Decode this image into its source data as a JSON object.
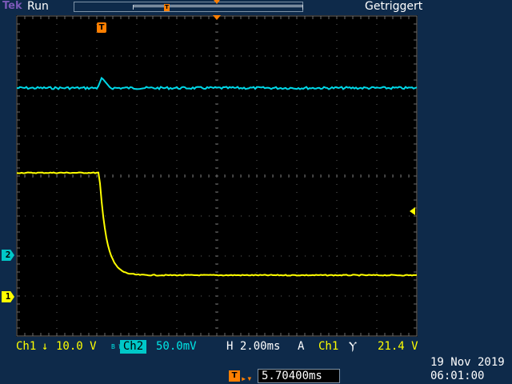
{
  "header": {
    "brand": "Tek",
    "acquisition_status": "Run",
    "trigger_status": "Getriggert"
  },
  "markers": {
    "trigger_point": "T",
    "ch1": "1",
    "ch2": "2"
  },
  "channels": {
    "ch1": {
      "label": "Ch1",
      "coupling_icon": "↓",
      "scale": "10.0 V",
      "color": "#ffff00"
    },
    "ch2": {
      "bw_label": "B W",
      "label": "Ch2",
      "scale": "50.0mV",
      "color": "#00e6e6"
    }
  },
  "timebase": {
    "scale": "H 2.00ms"
  },
  "trigger": {
    "mode": "A",
    "source": "Ch1",
    "slope_icon": "falling-edge-icon",
    "slope_glyph": "Ⲩ",
    "level": "21.4 V"
  },
  "trigger_position": {
    "icon": "T",
    "arrow": "▸▾",
    "value": "5.70400ms"
  },
  "datetime": {
    "date": "19 Nov 2019",
    "time": "06:01:00"
  },
  "colors": {
    "screen_background": "#000000",
    "frame_background": "#0e2a4a",
    "grid": "#6e6e6e",
    "trigger_marker": "#ff7f00"
  }
}
